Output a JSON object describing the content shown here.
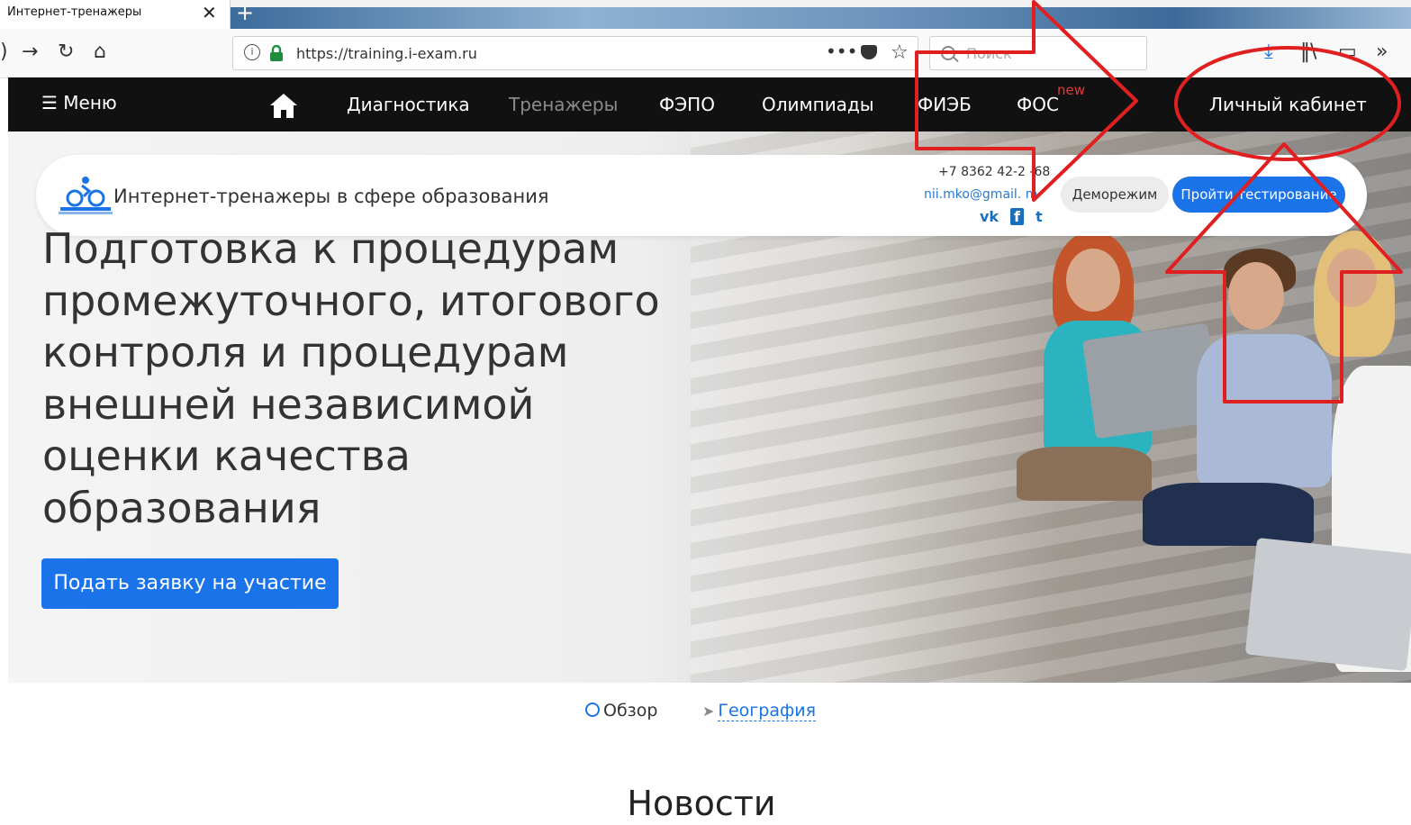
{
  "browser": {
    "tab_title": "Интернет-тренажеры",
    "tab_close": "✕",
    "new_tab": "+",
    "url": "https://training.i-exam.ru",
    "url_info": "i",
    "more_label": "•••",
    "search_placeholder": "Поиск",
    "overflow_label": "»"
  },
  "site_nav": {
    "menu_label": "☰ Меню",
    "items": [
      {
        "label": "Диагностика"
      },
      {
        "label": "Тренажеры"
      },
      {
        "label": "ФЭПО"
      },
      {
        "label": "Олимпиады"
      },
      {
        "label": "ФИЭБ"
      },
      {
        "label": "ФОС"
      }
    ],
    "new_badge": "new",
    "account_label": "Личный кабинет"
  },
  "header": {
    "site_title": "Интернет-тренажеры в сфере образования",
    "phone": "+7 8362 42-2 -68",
    "email": "nii.mko@gmail. m",
    "social": [
      "vk",
      "f",
      "t"
    ],
    "demo_button": "Деморежим",
    "test_button": "Пройти тестирование"
  },
  "hero": {
    "headline": "Подготовка к процедурам промежуточного, итогового контроля и процедурам внешней независимой оценки качества образования",
    "cta_label": "Подать заявку на участие"
  },
  "content_tabs": {
    "overview": "Обзор",
    "geography": "География"
  },
  "news_title": "Новости",
  "colors": {
    "nav_bg": "#111111",
    "accent_blue": "#1a73e8",
    "annotation_red": "#e02020",
    "new_badge": "#e53935"
  },
  "icons": [
    "back-icon",
    "forward-icon",
    "reload-icon",
    "home-icon",
    "info-icon",
    "lock-icon",
    "more-icon",
    "pocket-icon",
    "star-icon",
    "search-icon",
    "download-icon",
    "library-icon",
    "sidebar-icon",
    "overflow-icon",
    "site-home-icon",
    "bicycle-logo-icon",
    "vk-icon",
    "facebook-icon",
    "twitter-icon",
    "navigation-arrow-icon",
    "circle-o-icon"
  ]
}
